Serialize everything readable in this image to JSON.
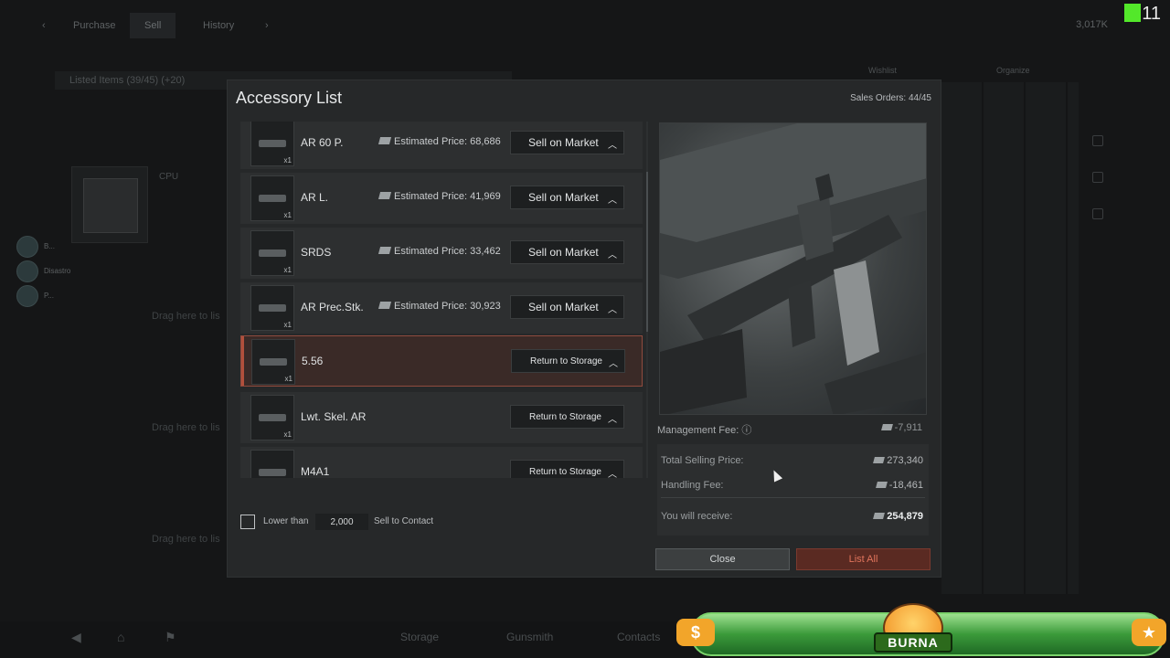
{
  "background": {
    "tabs": [
      "Purchase",
      "Sell",
      "History"
    ],
    "active_tab": "Sell",
    "currency_total": "3,017K",
    "overlay_number": "11",
    "listed_items": "Listed Items (39/45) (+20)",
    "cpu_label": "CPU",
    "drag_text": "Drag here to lis",
    "players": [
      {
        "name": "B..."
      },
      {
        "name": "Disastro"
      },
      {
        "name": "P..."
      }
    ],
    "wishlist": "Wishlist",
    "organize": "Organize",
    "bottom_nav": [
      "Storage",
      "Gunsmith",
      "Contacts"
    ]
  },
  "overlay": {
    "dollar": "$",
    "star": "★",
    "brand": "BURNA"
  },
  "modal": {
    "title": "Accessory List",
    "sales_orders": "Sales Orders: 44/45",
    "items": [
      {
        "name": "AR 60 P.",
        "qty": "x1",
        "price": "Estimated Price: 68,686",
        "action": "Sell on Market"
      },
      {
        "name": "AR L.",
        "qty": "x1",
        "price": "Estimated Price: 41,969",
        "action": "Sell on Market"
      },
      {
        "name": "SRDS",
        "qty": "x1",
        "price": "Estimated Price: 33,462",
        "action": "Sell on Market"
      },
      {
        "name": "AR Prec.Stk.",
        "qty": "x1",
        "price": "Estimated Price: 30,923",
        "action": "Sell on Market"
      },
      {
        "name": "5.56",
        "qty": "x1",
        "price": "",
        "action": "Return to Storage"
      },
      {
        "name": "Lwt. Skel. AR",
        "qty": "x1",
        "price": "",
        "action": "Return to Storage"
      },
      {
        "name": "M4A1",
        "qty": "",
        "price": "",
        "action": "Return to Storage"
      }
    ],
    "selected_index": 4,
    "lower_than_label": "Lower than",
    "lower_than_value": "2,000",
    "sell_to_contact": "Sell to Contact",
    "management_fee_label": "Management Fee:",
    "management_fee_value": "-7,911",
    "total_selling_label": "Total Selling Price:",
    "total_selling_value": "273,340",
    "handling_fee_label": "Handling Fee:",
    "handling_fee_value": "-18,461",
    "receive_label": "You will receive:",
    "receive_value": "254,879",
    "close_label": "Close",
    "list_all_label": "List All"
  }
}
